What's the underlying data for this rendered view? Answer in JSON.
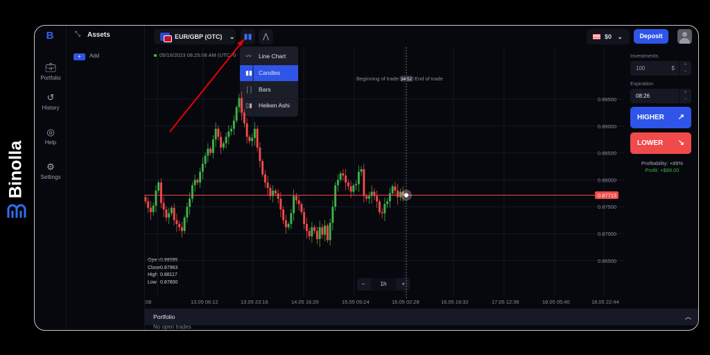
{
  "brand": {
    "name": "Binolla",
    "logo_color": "#2f6ff0"
  },
  "nav": {
    "items": [
      {
        "label": "Portfolio",
        "icon": "briefcase-icon"
      },
      {
        "label": "History",
        "icon": "history-icon"
      },
      {
        "label": "Help",
        "icon": "lifebuoy-icon"
      },
      {
        "label": "Settings",
        "icon": "gear-icon"
      }
    ]
  },
  "assets": {
    "title": "Assets",
    "add_label": "Add"
  },
  "toolbar": {
    "pair": "EUR/GBP (OTC)",
    "timestamp": "05/16/2023  08:25:08 AM  (UTC+0"
  },
  "chart_menu": {
    "items": [
      {
        "label": "Line Chart",
        "icon": "line-chart-icon"
      },
      {
        "label": "Candles",
        "icon": "candles-icon",
        "active": true
      },
      {
        "label": "Bars",
        "icon": "bars-icon"
      },
      {
        "label": "Heiken Ashi",
        "icon": "heiken-ashi-icon"
      }
    ]
  },
  "header": {
    "balance": "$0",
    "deposit": "Deposit"
  },
  "trade": {
    "investments_label": "Investments",
    "investment": "100",
    "currency": "$",
    "expiration_label": "Expiration",
    "expiration": "08:26",
    "higher": "HIGHER",
    "lower": "LOWER",
    "profitability": "Profitability: +89%",
    "profit": "Profit: +$89.00"
  },
  "chart_overlay": {
    "beginning": "Beginning of trade",
    "timer": "34:52",
    "end": "End of trade",
    "current_price": "0.87715"
  },
  "ohlc": {
    "open": "0.88095",
    "close": "0.87963",
    "high": "0.88117",
    "low": "0.87800",
    "open_label": "Open",
    "close_label": "Close",
    "high_label": "High",
    "low_label": "Low"
  },
  "timeframe": {
    "value": "1h",
    "minus": "−",
    "plus": "+"
  },
  "portfolio": {
    "title": "Portfolio",
    "empty": "No open trades"
  },
  "colors": {
    "up": "#3fb14a",
    "down": "#f04a4a",
    "accent": "#2f55e8"
  },
  "chart_data": {
    "type": "candlestick",
    "y_ticks": [
      "0.89500",
      "0.89000",
      "0.88500",
      "0.88000",
      "0.87500",
      "0.87000",
      "0.86500"
    ],
    "ylim": [
      0.8635,
      0.8975
    ],
    "x_ticks": [
      ":08",
      "13.05 06:12",
      "13.05 23:16",
      "14.05 16:20",
      "15.05 09:24",
      "16.05 02:28",
      "16.05 19:32",
      "17.05 12:36",
      "18.05 05:40",
      "18.05 22:44"
    ],
    "closes": [
      0.876,
      0.8748,
      0.874,
      0.8752,
      0.878,
      0.8795,
      0.8757,
      0.8745,
      0.873,
      0.8738,
      0.8748,
      0.8725,
      0.8718,
      0.8712,
      0.8705,
      0.873,
      0.875,
      0.8765,
      0.879,
      0.88,
      0.8795,
      0.8815,
      0.883,
      0.8845,
      0.8858,
      0.885,
      0.8875,
      0.8895,
      0.888,
      0.886,
      0.8868,
      0.888,
      0.889,
      0.8895,
      0.891,
      0.8935,
      0.8952,
      0.8925,
      0.8905,
      0.888,
      0.8872,
      0.8878,
      0.8895,
      0.886,
      0.8835,
      0.881,
      0.8795,
      0.8785,
      0.877,
      0.878,
      0.8775,
      0.8765,
      0.8745,
      0.8725,
      0.8712,
      0.8718,
      0.8738,
      0.877,
      0.8762,
      0.8755,
      0.874,
      0.8718,
      0.8705,
      0.8695,
      0.8712,
      0.8705,
      0.869,
      0.8712,
      0.8698,
      0.8715,
      0.8688,
      0.872,
      0.875,
      0.879,
      0.88,
      0.8812,
      0.8808,
      0.8795,
      0.8788,
      0.8778,
      0.879,
      0.8792,
      0.8815,
      0.882,
      0.877,
      0.8765,
      0.877,
      0.8778,
      0.877,
      0.876,
      0.874,
      0.8738,
      0.8755,
      0.876,
      0.8775,
      0.8788,
      0.878,
      0.8768,
      0.8778,
      0.87715
    ],
    "current_price": 0.87715
  }
}
